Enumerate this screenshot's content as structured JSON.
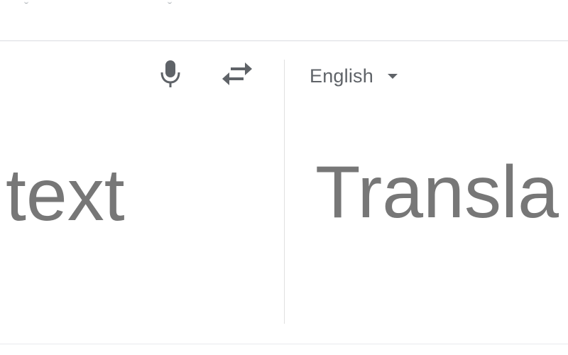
{
  "source": {
    "text": "text",
    "mic_icon": "microphone-icon"
  },
  "swap": {
    "icon": "swap-arrows-icon"
  },
  "target": {
    "language": "English",
    "caret_icon": "caret-down-icon",
    "text": "Transla"
  },
  "colors": {
    "text_placeholder": "#777777",
    "icon": "#5f6368",
    "divider": "#e0e0e0",
    "border": "#dadce0"
  }
}
